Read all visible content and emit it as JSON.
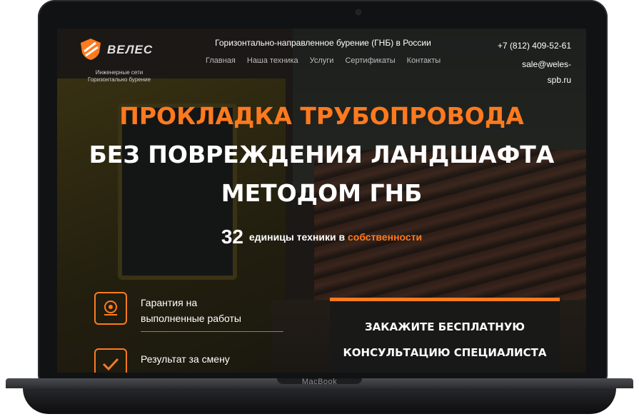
{
  "device": {
    "brand_label": "MacBook"
  },
  "site": {
    "logo_name": "ВЕЛЕС",
    "logo_subtitle": "Инженерные сети Горизонтально бурение",
    "tagline": "Горизонтально-направленное бурение (ГНБ) в России",
    "nav": [
      "Главная",
      "Наша техника",
      "Услуги",
      "Сертификаты",
      "Контакты"
    ],
    "phone": "+7 (812) 409-52-61",
    "email": "sale@weles-spb.ru"
  },
  "hero": {
    "line1": "ПРОКЛАДКА ТРУБОПРОВОДА",
    "line2": "БЕЗ ПОВРЕЖДЕНИЯ ЛАНДШАФТА",
    "line3": "МЕТОДОМ ГНБ",
    "stat_number": "32",
    "stat_text": "единицы техники в",
    "stat_accent": "собственности"
  },
  "features": [
    {
      "icon": "medal-icon",
      "text": "Гарантия на выполненные работы"
    },
    {
      "icon": "checkbox-icon",
      "text": "Результат за смену"
    }
  ],
  "cta": {
    "line1": "ЗАКАЖИТЕ БЕСПЛАТНУЮ",
    "line2": "КОНСУЛЬТАЦИЮ СПЕЦИАЛИСТА"
  },
  "colors": {
    "accent": "#ff7a1e",
    "text": "#ffffff",
    "frame": "#111213"
  }
}
